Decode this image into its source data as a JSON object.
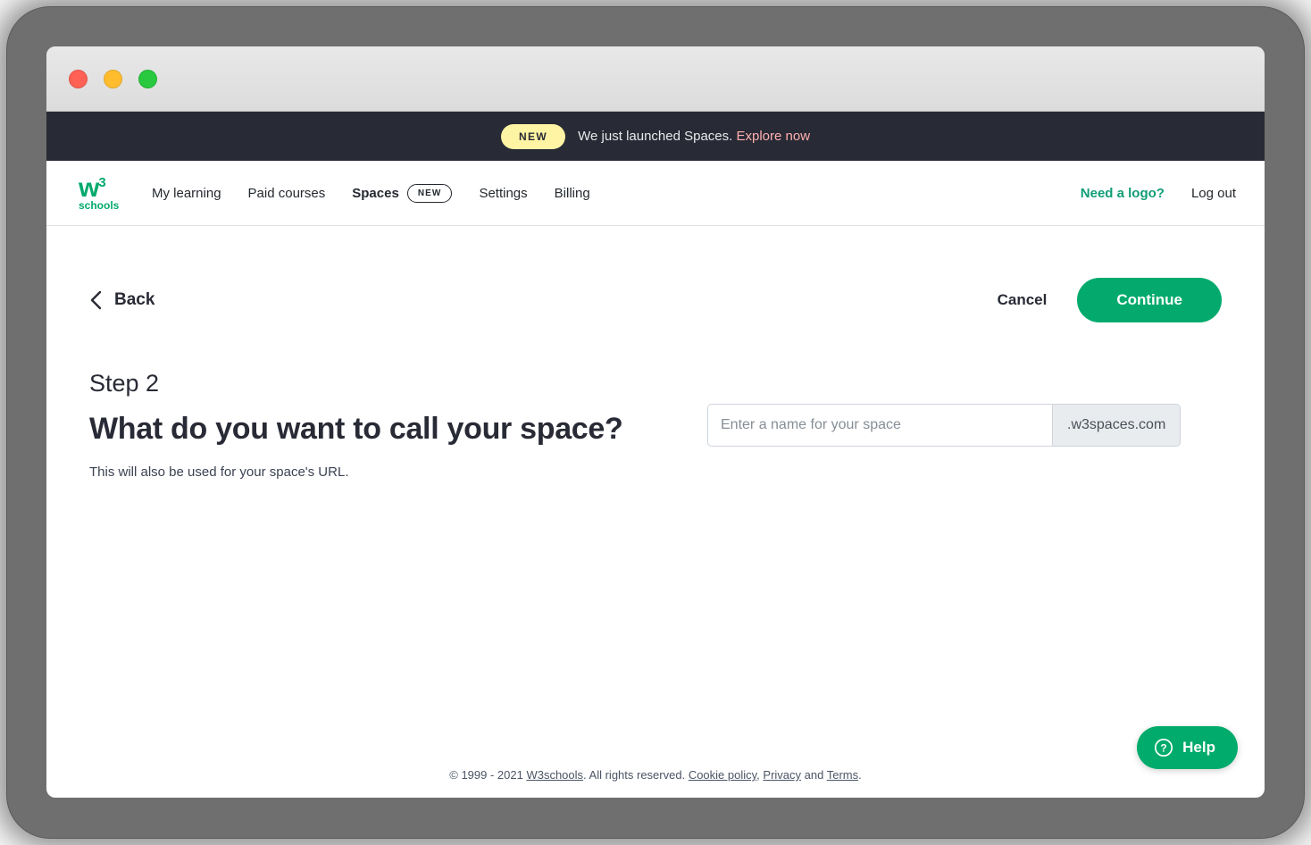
{
  "window": {
    "traffic_lights": [
      {
        "name": "close",
        "color": "#ff6155"
      },
      {
        "name": "minimize",
        "color": "#ffbd2e"
      },
      {
        "name": "maximize",
        "color": "#28c93f"
      }
    ]
  },
  "promo_banner": {
    "badge": "NEW",
    "text": "We just launched Spaces.",
    "link": "Explore now",
    "background": "#282a35",
    "badge_color": "#fff4a3",
    "link_color": "#ffb0b0"
  },
  "nav": {
    "logo": {
      "mark": "w",
      "superscript": "3",
      "word": "schools",
      "color": "#04aa6d"
    },
    "items": [
      {
        "label": "My learning",
        "active": false
      },
      {
        "label": "Paid courses",
        "active": false
      },
      {
        "label": "Spaces",
        "active": true,
        "badge": "NEW"
      },
      {
        "label": "Settings",
        "active": false
      },
      {
        "label": "Billing",
        "active": false
      }
    ],
    "need_logo": "Need a logo?",
    "need_logo_color": "#0f9d76",
    "log_out": "Log out"
  },
  "actions": {
    "back": "Back",
    "cancel": "Cancel",
    "continue": "Continue",
    "continue_color": "#04aa6d"
  },
  "step": {
    "label": "Step 2",
    "heading": "What do you want to call your space?",
    "subtext": "This will also be used for your space's URL."
  },
  "space_name_field": {
    "value": "",
    "placeholder": "Enter a name for your space",
    "suffix": ".w3spaces.com"
  },
  "footer": {
    "copyright": "© 1999 - 2021 ",
    "brand": "W3schools",
    "rights": ". All rights reserved. ",
    "cookie_policy": "Cookie policy",
    "separator": ", ",
    "privacy": "Privacy",
    "and": " and ",
    "terms": "Terms",
    "period": "."
  },
  "help_widget": {
    "label": "Help",
    "color": "#00ab6b"
  }
}
